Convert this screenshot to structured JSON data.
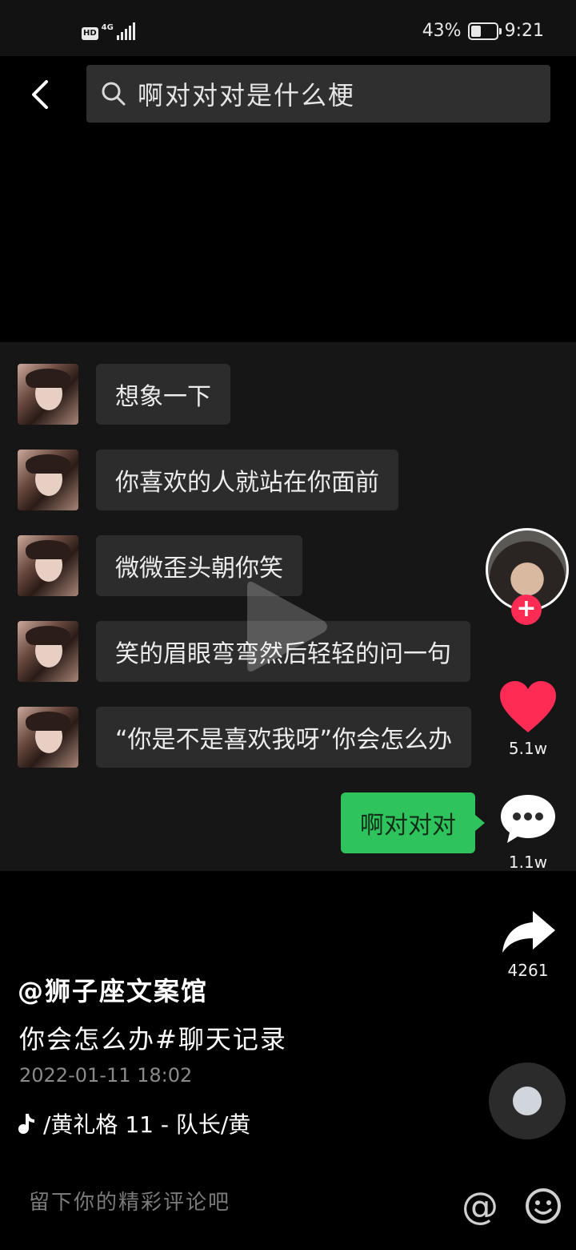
{
  "status_bar": {
    "hd": "HD",
    "network": "4G",
    "battery_percent": "43%",
    "battery_level": 0.43,
    "time": "9:21"
  },
  "search": {
    "query": "啊对对对是什么梗",
    "back_icon": "chevron-left-icon",
    "search_icon": "magnifier-icon"
  },
  "chat": {
    "messages": [
      {
        "text": "想象一下"
      },
      {
        "text": "你喜欢的人就站在你面前"
      },
      {
        "text": "微微歪头朝你笑"
      },
      {
        "text": "笑的眉眼弯弯然后轻轻的问一句"
      },
      {
        "text": "“你是不是喜欢我呀”你会怎么办"
      }
    ],
    "reply": {
      "text": "啊对对对"
    }
  },
  "actions": {
    "like_count": "5.1w",
    "comment_count": "1.1w",
    "share_count": "4261",
    "follow_label": "+",
    "like_color": "#fe2c55"
  },
  "post": {
    "author": "@狮子座文案馆",
    "caption": "你会怎么办#聊天记录",
    "date": "2022-01-11 18:02",
    "music": "/黄礼格     11 - 队长/黄"
  },
  "comment_bar": {
    "placeholder": "留下你的精彩评论吧",
    "at_label": "@"
  }
}
